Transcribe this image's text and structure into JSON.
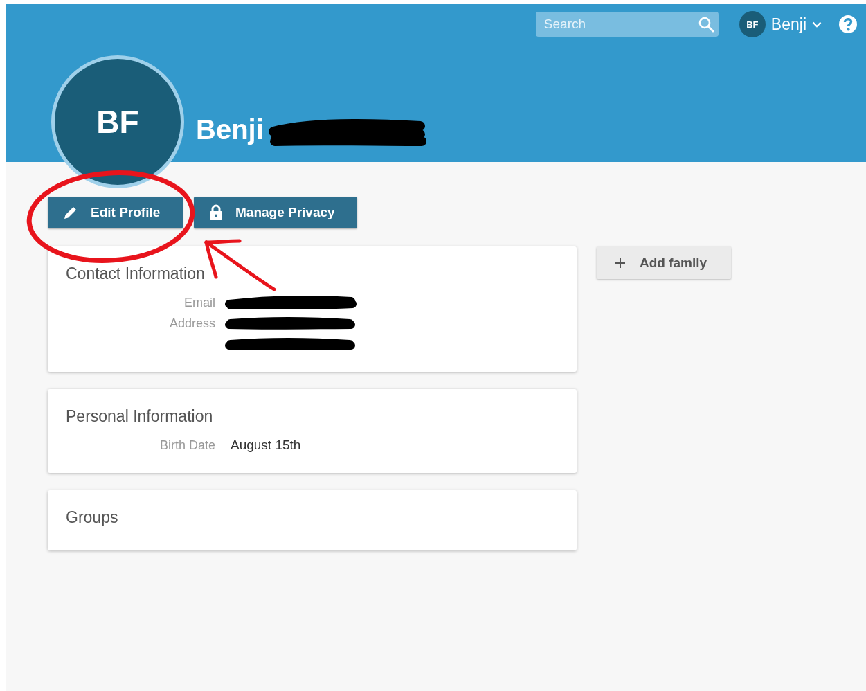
{
  "header": {
    "search": {
      "placeholder": "Search"
    },
    "user": {
      "initials": "BF",
      "name": "Benji"
    }
  },
  "profile": {
    "initials": "BF",
    "name": "Benji",
    "surname_redacted": true
  },
  "actions": [
    {
      "label": "Edit Profile",
      "kind": "edit"
    },
    {
      "label": "Manage Privacy",
      "kind": "lock"
    }
  ],
  "sections": [
    {
      "title": "Contact Information",
      "fields": [
        {
          "kind": "labeled",
          "label": "Email",
          "redacted": true
        },
        {
          "kind": "labeled",
          "label": "Address",
          "redacted": true
        },
        {
          "kind": "continuation",
          "redacted": true
        }
      ]
    },
    {
      "title": "Personal Information",
      "fields": [
        {
          "kind": "labeled",
          "label": "Birth Date",
          "value": "August 15th",
          "redacted": false
        }
      ]
    },
    {
      "title": "Groups"
    }
  ],
  "side_actions": [
    {
      "label": "Add family",
      "kind": "add"
    }
  ],
  "annotations": {
    "circle": true,
    "arrow": true
  }
}
